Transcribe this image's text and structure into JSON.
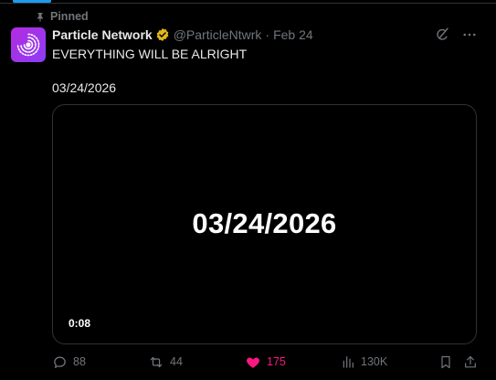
{
  "pinned": {
    "label": "Pinned",
    "icon": "pin-icon"
  },
  "author": {
    "display_name": "Particle Network",
    "handle": "@ParticleNtwrk",
    "separator": "·",
    "date": "Feb 24",
    "verified": true,
    "verified_color": "#e2b719",
    "avatar_colors": [
      "#b32be0",
      "#8c3df4"
    ]
  },
  "tweet": {
    "text_line1": "EVERYTHING WILL BE ALRIGHT",
    "text_line2": "03/24/2026"
  },
  "media": {
    "title": "03/24/2026",
    "duration": "0:08"
  },
  "actions": {
    "reply_count": "88",
    "repost_count": "44",
    "like_count": "175",
    "views_count": "130K",
    "like_color": "#f91880"
  },
  "colors": {
    "background": "#000000",
    "text_primary": "#e7e9ea",
    "text_secondary": "#71767b",
    "accent": "#1d9bf0",
    "border": "#2f3336"
  }
}
